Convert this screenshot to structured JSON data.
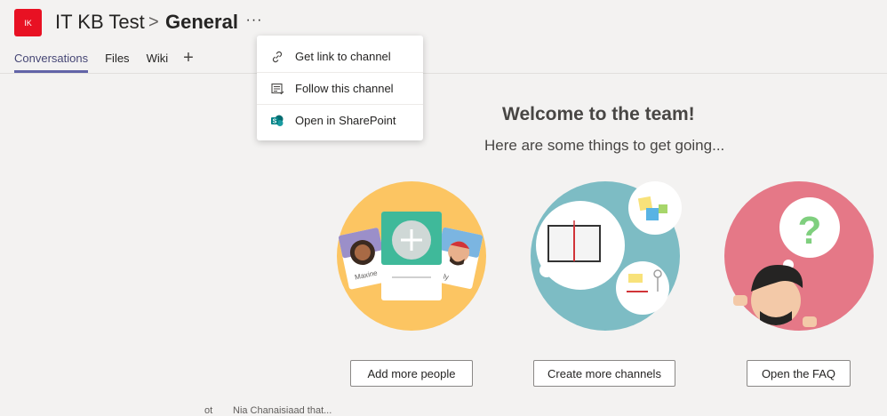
{
  "header": {
    "team_initials": "IK",
    "team_name": "IT KB Test",
    "separator": ">",
    "channel_name": "General",
    "more_label": "···"
  },
  "tabs": [
    {
      "label": "Conversations",
      "active": true
    },
    {
      "label": "Files",
      "active": false
    },
    {
      "label": "Wiki",
      "active": false
    }
  ],
  "add_tab_label": "+",
  "channel_menu": [
    {
      "label": "Get link to channel",
      "icon": "link-icon"
    },
    {
      "label": "Follow this channel",
      "icon": "follow-channel-icon"
    },
    {
      "label": "Open in SharePoint",
      "icon": "sharepoint-icon"
    }
  ],
  "welcome": {
    "title": "Welcome to the team!",
    "subtitle": "Here are some things to get going..."
  },
  "cards": [
    {
      "button": "Add more people",
      "name_left": "Maxine",
      "name_right": "ly"
    },
    {
      "button": "Create more channels"
    },
    {
      "button": "Open the FAQ"
    }
  ],
  "feed_fragment": {
    "left": "ot",
    "right": "Nia Chanaisiaad that..."
  },
  "colors": {
    "accent": "#6264a7",
    "team_avatar": "#e81123",
    "people_circle": "#fcc562",
    "channels_circle": "#7dbcc4",
    "faq_circle": "#e57887"
  }
}
